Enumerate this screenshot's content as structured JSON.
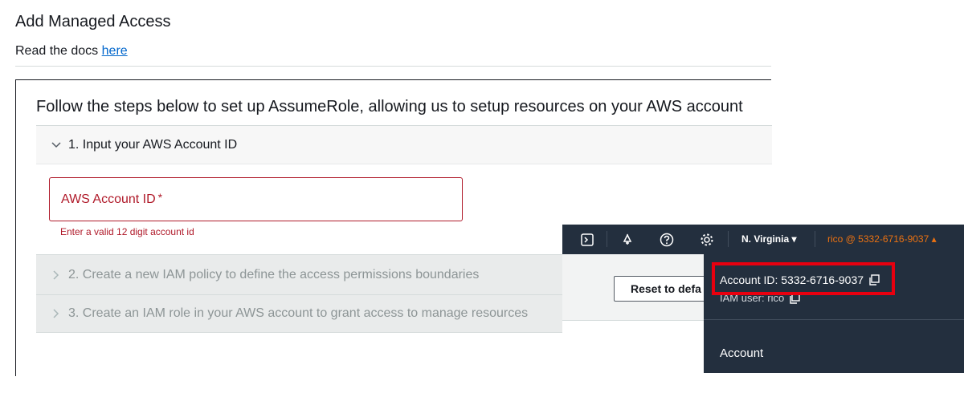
{
  "page": {
    "title": "Add Managed Access",
    "docs_prefix": "Read the docs",
    "docs_link": "here"
  },
  "panel": {
    "heading": "Follow the steps below to set up AssumeRole, allowing us to setup resources on your AWS account",
    "steps": [
      {
        "label": "1. Input your AWS Account ID",
        "expanded": true
      },
      {
        "label": "2. Create a new IAM policy to define the access permissions boundaries",
        "expanded": false
      },
      {
        "label": "3. Create an IAM role in your AWS account to grant access to manage resources",
        "expanded": false
      }
    ],
    "account_field": {
      "placeholder": "AWS Account ID",
      "required_mark": "*",
      "value": "",
      "error": "Enter a valid 12 digit account id"
    }
  },
  "console": {
    "icons": [
      "terminal-icon",
      "bell-icon",
      "help-icon",
      "gear-icon"
    ],
    "region": "N. Virginia ▾",
    "user_menu": "rico @ 5332-6716-9037 ▴",
    "reset_button": "Reset to defa",
    "dropdown": {
      "account_id": "Account ID: 5332-6716-9037",
      "iam_user": "IAM user: rico",
      "account_section": "Account"
    }
  },
  "colors": {
    "error": "#b01a2a",
    "link": "#0066cc",
    "console_dark": "#232f3e",
    "console_orange": "#ec7211",
    "highlight": "#e8000f"
  }
}
